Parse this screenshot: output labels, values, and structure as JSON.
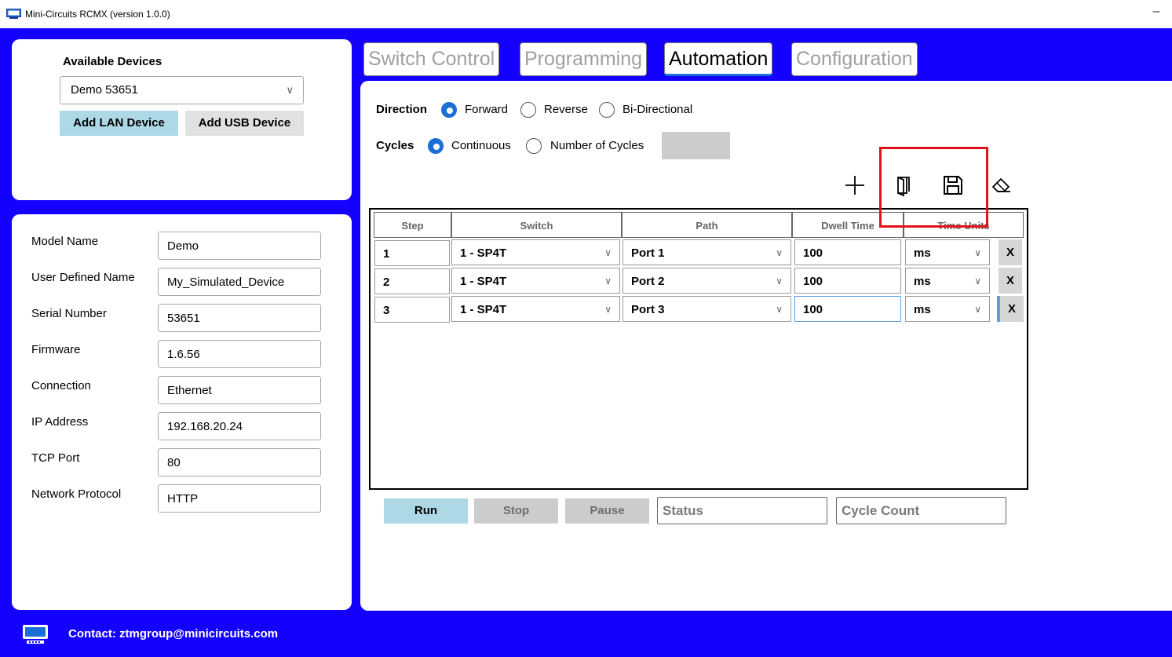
{
  "window": {
    "title": "Mini-Circuits RCMX (version 1.0.0)",
    "minimize_glyph": "–"
  },
  "devices": {
    "heading": "Available Devices",
    "selected": "Demo  53651",
    "add_lan_label": "Add LAN Device",
    "add_usb_label": "Add USB Device"
  },
  "device_info": {
    "rows": [
      {
        "label": "Model Name",
        "value": "Demo"
      },
      {
        "label": "User Defined Name",
        "value": "My_Simulated_Device"
      },
      {
        "label": "Serial Number",
        "value": "53651"
      },
      {
        "label": "Firmware",
        "value": "1.6.56"
      },
      {
        "label": "Connection",
        "value": "Ethernet"
      },
      {
        "label": "IP Address",
        "value": "192.168.20.24"
      },
      {
        "label": "TCP Port",
        "value": "80"
      },
      {
        "label": "Network Protocol",
        "value": "HTTP"
      }
    ]
  },
  "tabs": [
    {
      "label": "Switch Control"
    },
    {
      "label": "Programming"
    },
    {
      "label": "Automation"
    },
    {
      "label": "Configuration"
    }
  ],
  "active_tab": "Automation",
  "direction": {
    "label": "Direction",
    "options": [
      "Forward",
      "Reverse",
      "Bi-Directional"
    ],
    "selected": "Forward"
  },
  "cycles": {
    "label": "Cycles",
    "options": [
      "Continuous",
      "Number of Cycles"
    ],
    "selected": "Continuous",
    "count_value": ""
  },
  "toolbar_icons": [
    "add-step-icon",
    "open-file-icon",
    "save-icon",
    "clear-eraser-icon"
  ],
  "table": {
    "headers": [
      "Step",
      "Switch",
      "Path",
      "Dwell Time",
      "Time Units"
    ],
    "rows": [
      {
        "step": "1",
        "switch": "1 - SP4T",
        "path": "Port 1",
        "dwell": "100",
        "units": "ms",
        "delete": "X"
      },
      {
        "step": "2",
        "switch": "1 - SP4T",
        "path": "Port 2",
        "dwell": "100",
        "units": "ms",
        "delete": "X"
      },
      {
        "step": "3",
        "switch": "1 - SP4T",
        "path": "Port 3",
        "dwell": "100",
        "units": "ms",
        "delete": "X"
      }
    ]
  },
  "controls": {
    "run_label": "Run",
    "stop_label": "Stop",
    "pause_label": "Pause",
    "status_placeholder": "Status",
    "cycle_count_placeholder": "Cycle Count"
  },
  "footer": {
    "contact": "Contact: ztmgroup@minicircuits.com"
  },
  "colors": {
    "background_blue": "#1400ff",
    "accent_blue": "#1a6fd6",
    "primary_button": "#add8e6",
    "highlight_red": "#e0131a"
  }
}
